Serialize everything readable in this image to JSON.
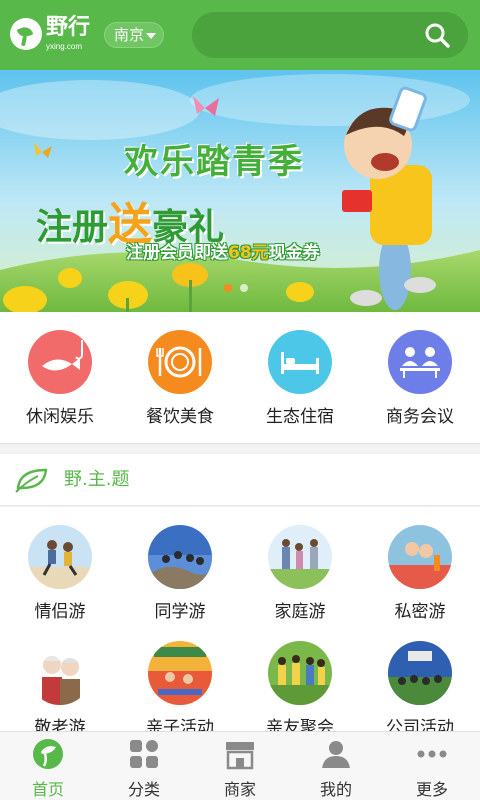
{
  "header": {
    "logo_name": "野行",
    "logo_sub": "yxing.com",
    "city": "南京",
    "icons": [
      "logo-icon",
      "chevron-down-icon",
      "search-icon"
    ]
  },
  "banner": {
    "title": "欢乐踏青季",
    "sub_before": "注册",
    "sub_highlight": "送",
    "sub_after": "豪礼",
    "note_before": "注册会员即送",
    "note_money": "68元",
    "note_after": "现金券",
    "slide_count": 2,
    "active_slide": 1
  },
  "categories": [
    {
      "label": "休闲娱乐",
      "icon": "fish-icon",
      "color": "#f26b6b"
    },
    {
      "label": "餐饮美食",
      "icon": "dining-plate-icon",
      "color": "#f58a1f"
    },
    {
      "label": "生态住宿",
      "icon": "bed-icon",
      "color": "#4cc7e8"
    },
    {
      "label": "商务会议",
      "icon": "meeting-icon",
      "color": "#6d7ee8"
    }
  ],
  "theme": {
    "title": "野.主.题",
    "icon": "leaf-icon",
    "items": [
      {
        "label": "情侣游"
      },
      {
        "label": "同学游"
      },
      {
        "label": "家庭游"
      },
      {
        "label": "私密游"
      },
      {
        "label": "敬老游"
      },
      {
        "label": "亲子活动"
      },
      {
        "label": "亲友聚会"
      },
      {
        "label": "公司活动"
      }
    ]
  },
  "nav": {
    "items": [
      {
        "label": "首页",
        "icon": "home-logo-icon",
        "active": true
      },
      {
        "label": "分类",
        "icon": "grid-icon",
        "active": false
      },
      {
        "label": "商家",
        "icon": "store-icon",
        "active": false
      },
      {
        "label": "我的",
        "icon": "user-icon",
        "active": false
      },
      {
        "label": "更多",
        "icon": "more-icon",
        "active": false
      }
    ]
  },
  "colors": {
    "brand_green": "#58b84a",
    "search_bg": "#4aa33d",
    "active_dot": "#f58a1f"
  }
}
